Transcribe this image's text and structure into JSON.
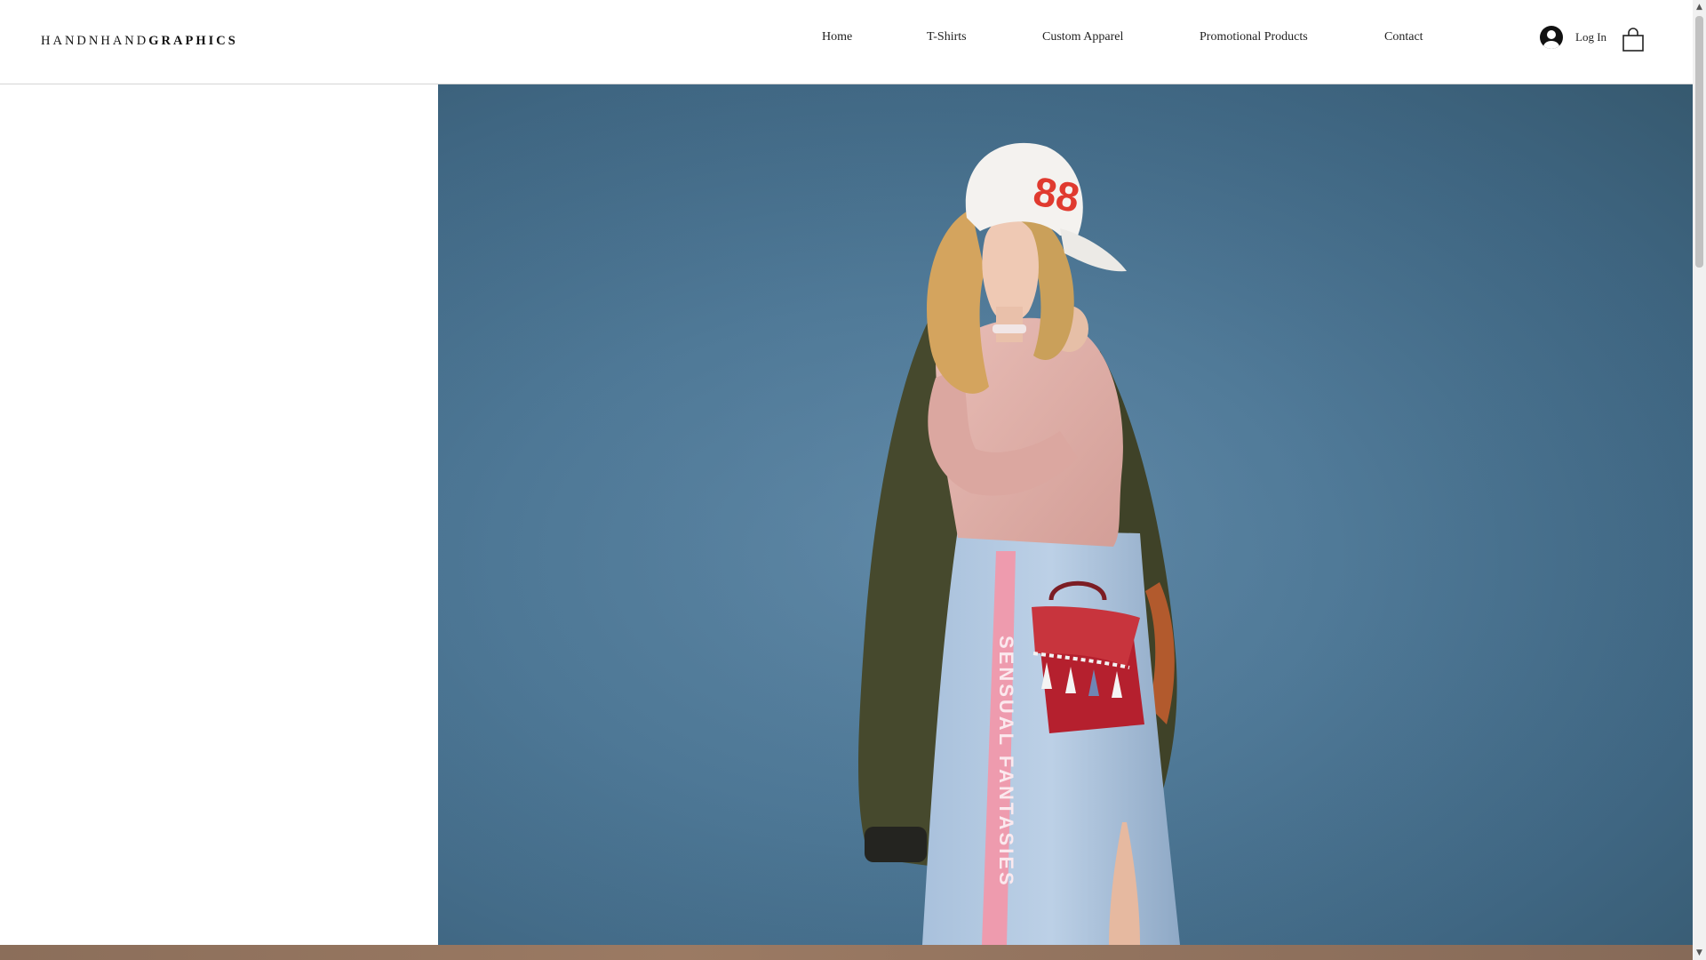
{
  "site": {
    "logo_light": "HANDNHAND",
    "logo_bold": "GRAPHICS"
  },
  "nav": {
    "items": [
      {
        "label": "Home"
      },
      {
        "label": "T-Shirts"
      },
      {
        "label": "Custom Apparel"
      },
      {
        "label": "Promotional Products"
      },
      {
        "label": "Contact"
      }
    ]
  },
  "account": {
    "login_label": "Log In",
    "login_icon": "user-avatar-icon",
    "cart_icon": "shopping-bag-icon"
  },
  "hero": {
    "image_subject": "fashion model in white cap, pink sweater, denim skirt with red handbag",
    "background_color": "#4f7a99",
    "cap_text": "88",
    "skirt_stripe_text": "SENSUAL FANTASIES"
  },
  "colors": {
    "header_bg": "#ffffff",
    "text": "#222222",
    "band": "#8b6e5a"
  }
}
